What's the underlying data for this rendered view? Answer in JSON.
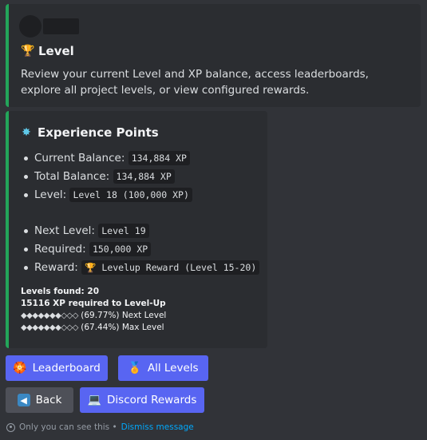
{
  "embed_level": {
    "title": "Level",
    "title_icon": "trophy-icon",
    "description": "Review your current Level and XP balance, access leaderboards, explore all project levels, or view configured rewards."
  },
  "embed_xp": {
    "title": "Experience Points",
    "title_icon": "sparkle-icon",
    "current_balance_label": "Current Balance:",
    "current_balance_value": "134,884 XP",
    "total_balance_label": "Total Balance:",
    "total_balance_value": "134,884 XP",
    "level_label": "Level:",
    "level_value": "Level 18 (100,000 XP)",
    "next_level_label": "Next Level:",
    "next_level_value": "Level 19",
    "required_label": "Required:",
    "required_value": "150,000 XP",
    "reward_label": "Reward:",
    "reward_value": "Levelup Reward (Level 15-20)",
    "levels_found": "Levels found: 20",
    "xp_required": "15116 XP required to Level-Up",
    "next_progress_bar": "◆◆◆◆◆◆◆◇◇◇",
    "next_progress_text": "(69.77%) Next Level",
    "next_progress": 0.6977,
    "max_progress_bar": "◆◆◆◆◆◆◆◇◇◇",
    "max_progress_text": "(67.44%) Max Level",
    "max_progress": 0.6744
  },
  "buttons": {
    "leaderboard": "Leaderboard",
    "all_levels": "All Levels",
    "back": "Back",
    "discord_rewards": "Discord Rewards"
  },
  "ephemeral": {
    "text": "Only you can see this •",
    "dismiss": "Dismiss message"
  },
  "colors": {
    "accent_bar": "#23a55a",
    "primary_button": "#5865f2",
    "secondary_button": "#4e5058",
    "link": "#00a8fc"
  }
}
